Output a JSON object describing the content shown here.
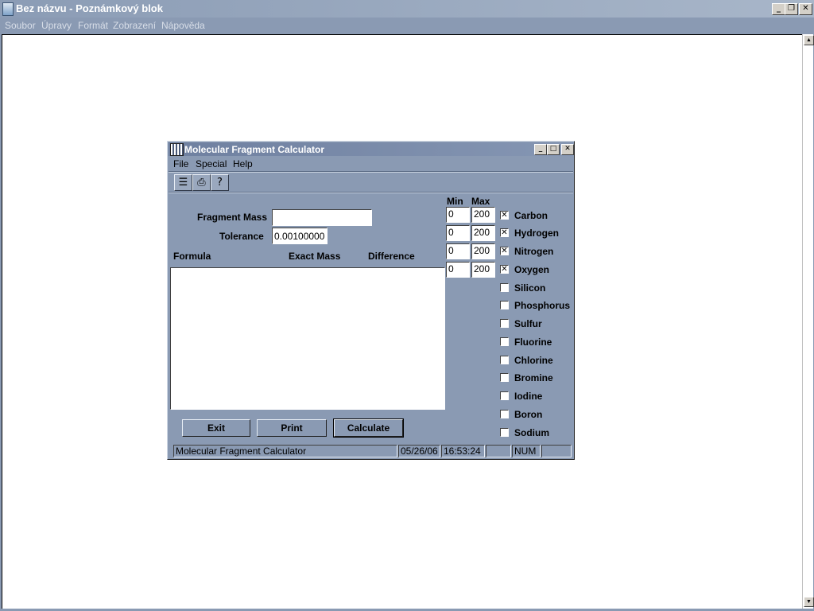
{
  "notepad": {
    "title": "Bez názvu - Poznámkový blok",
    "menu": [
      "Soubor",
      "Úpravy",
      "Formát",
      "Zobrazení",
      "Nápověda"
    ],
    "caption_buttons": {
      "minimize": "_",
      "restore": "❐",
      "close": "✕"
    }
  },
  "app": {
    "title": "Molecular Fragment Calculator",
    "menu": [
      "File",
      "Special",
      "Help"
    ],
    "toolbar": [
      "open-icon",
      "print-icon",
      "help-icon"
    ],
    "fragment_mass_label": "Fragment Mass",
    "fragment_mass_value": "",
    "tolerance_label": "Tolerance",
    "tolerance_value": "0.00100000",
    "columns": [
      "Formula",
      "Exact Mass",
      "Difference"
    ],
    "min_label": "Min",
    "max_label": "Max",
    "elements": [
      {
        "name": "Carbon",
        "checked": true,
        "min": "0",
        "max": "200"
      },
      {
        "name": "Hydrogen",
        "checked": true,
        "min": "0",
        "max": "200"
      },
      {
        "name": "Nitrogen",
        "checked": true,
        "min": "0",
        "max": "200"
      },
      {
        "name": "Oxygen",
        "checked": true,
        "min": "0",
        "max": "200"
      },
      {
        "name": "Silicon",
        "checked": false
      },
      {
        "name": "Phosphorus",
        "checked": false
      },
      {
        "name": "Sulfur",
        "checked": false
      },
      {
        "name": "Fluorine",
        "checked": false
      },
      {
        "name": "Chlorine",
        "checked": false
      },
      {
        "name": "Bromine",
        "checked": false
      },
      {
        "name": "Iodine",
        "checked": false
      },
      {
        "name": "Boron",
        "checked": false
      },
      {
        "name": "Sodium",
        "checked": false
      }
    ],
    "buttons": {
      "exit": "Exit",
      "print": "Print",
      "calculate": "Calculate"
    },
    "status": {
      "message": "Molecular Fragment Calculator",
      "date": "05/26/06",
      "time": "16:53:24",
      "caps": "",
      "num": "NUM",
      "scroll": ""
    }
  }
}
